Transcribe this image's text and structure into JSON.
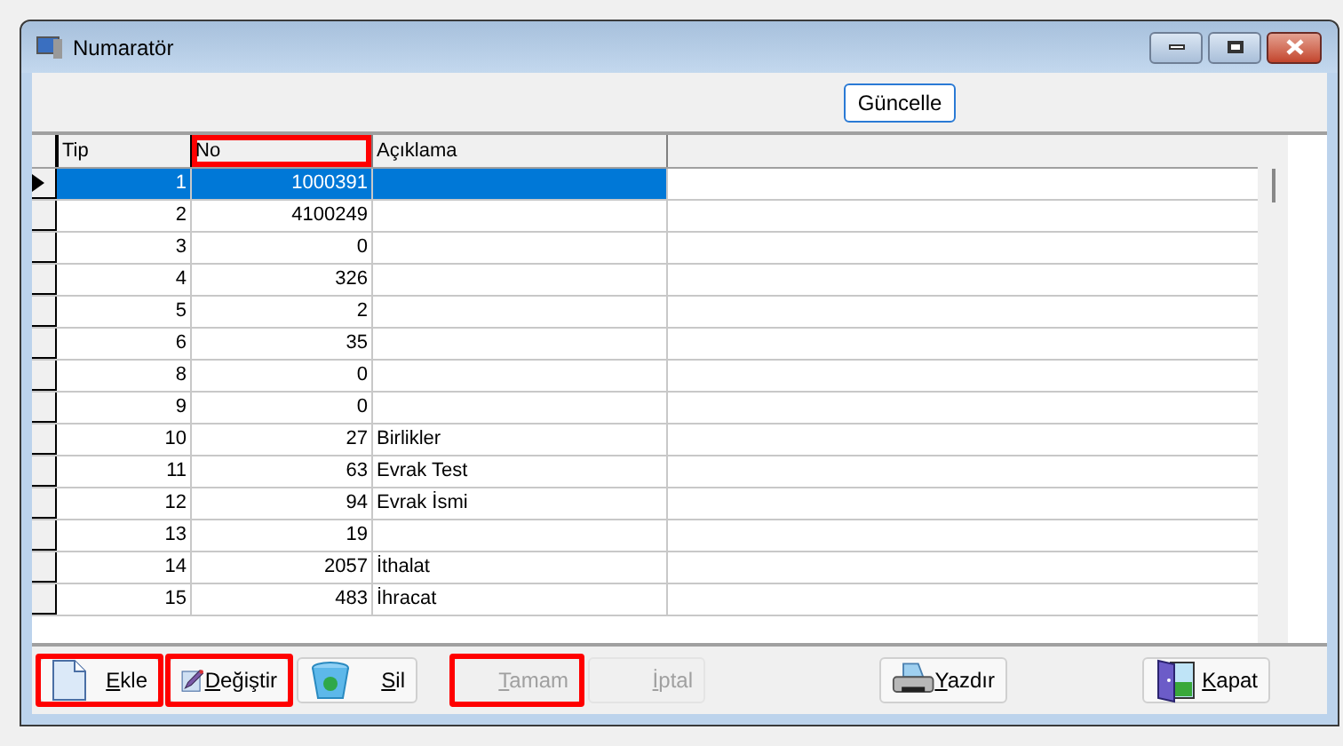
{
  "window": {
    "title": "Numaratör"
  },
  "toolbar": {
    "refresh_button": {
      "label": "Güncelle"
    }
  },
  "table": {
    "columns": [
      {
        "label": "Tip",
        "highlighted": false
      },
      {
        "label": "No",
        "highlighted": true
      },
      {
        "label": "Açıklama",
        "highlighted": false
      }
    ],
    "rows": [
      {
        "tip": "1",
        "no": "1000391",
        "aciklama": "",
        "selected": true
      },
      {
        "tip": "2",
        "no": "4100249",
        "aciklama": "",
        "selected": false
      },
      {
        "tip": "3",
        "no": "0",
        "aciklama": "",
        "selected": false
      },
      {
        "tip": "4",
        "no": "326",
        "aciklama": "",
        "selected": false
      },
      {
        "tip": "5",
        "no": "2",
        "aciklama": "",
        "selected": false
      },
      {
        "tip": "6",
        "no": "35",
        "aciklama": "",
        "selected": false
      },
      {
        "tip": "8",
        "no": "0",
        "aciklama": "",
        "selected": false
      },
      {
        "tip": "9",
        "no": "0",
        "aciklama": "",
        "selected": false
      },
      {
        "tip": "10",
        "no": "27",
        "aciklama": "Birlikler",
        "selected": false
      },
      {
        "tip": "11",
        "no": "63",
        "aciklama": "Evrak Test",
        "selected": false
      },
      {
        "tip": "12",
        "no": "94",
        "aciklama": "Evrak İsmi",
        "selected": false
      },
      {
        "tip": "13",
        "no": "19",
        "aciklama": "",
        "selected": false
      },
      {
        "tip": "14",
        "no": "2057",
        "aciklama": "İthalat",
        "selected": false
      },
      {
        "tip": "15",
        "no": "483",
        "aciklama": "İhracat",
        "selected": false
      }
    ]
  },
  "buttons": [
    {
      "label": "Ekle",
      "kind": "page",
      "disabled": false,
      "highlighted": true
    },
    {
      "label": "Değiştir",
      "kind": "pencil",
      "disabled": false,
      "highlighted": true
    },
    {
      "label": "Sil",
      "kind": "bin",
      "disabled": false,
      "highlighted": false
    },
    {
      "label": "Tamam",
      "kind": "plain",
      "disabled": true,
      "highlighted": true
    },
    {
      "label": "İptal",
      "kind": "plain",
      "disabled": true,
      "highlighted": false
    },
    {
      "label": "Yazdır",
      "kind": "printer",
      "disabled": false,
      "highlighted": false
    },
    {
      "label": "Kapat",
      "kind": "door",
      "disabled": false,
      "highlighted": false
    }
  ]
}
